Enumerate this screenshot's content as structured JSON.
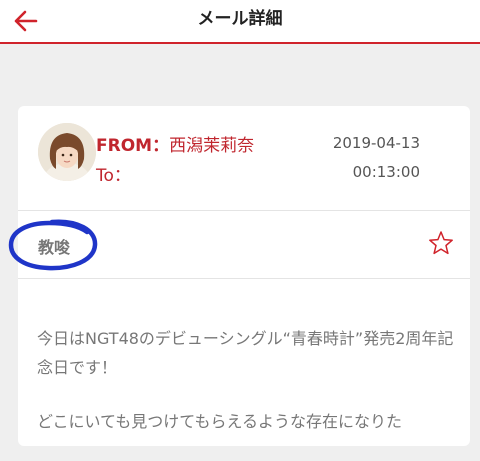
{
  "header": {
    "title": "メール詳細",
    "back_icon": "back-arrow-icon"
  },
  "mail": {
    "from_label": "FROM：",
    "from_name": "西潟茉莉奈",
    "to_label": "To：",
    "date": "2019-04-13",
    "time": "00:13:00",
    "subject": "教唆",
    "star_icon": "star-outline-icon",
    "body_paragraph_1": "今日はNGT48のデビューシングル“青春時計”発売2周年記念日です！",
    "body_paragraph_2": "どこにいても見つけてもらえるような存在になりた"
  },
  "colors": {
    "accent": "#d0232b",
    "annotation": "#1f35c8",
    "background": "#efefef"
  }
}
